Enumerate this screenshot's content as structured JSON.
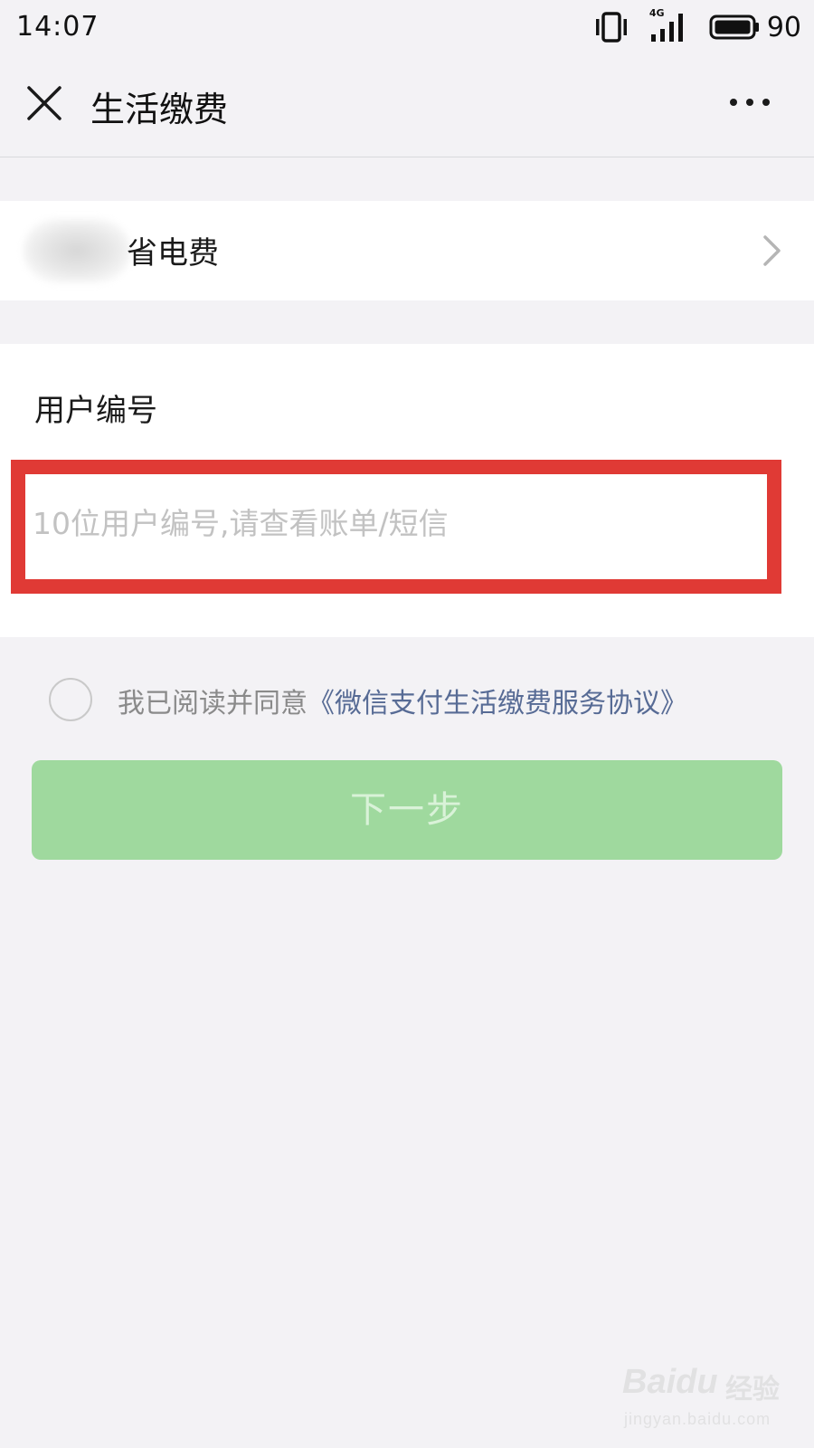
{
  "status_bar": {
    "time": "14:07",
    "network": "4G",
    "battery": "90"
  },
  "nav": {
    "title": "生活缴费"
  },
  "provider": {
    "label": "省电费"
  },
  "form": {
    "field_label": "用户编号",
    "account_placeholder": "10位用户编号,请查看账单/短信",
    "account_value": ""
  },
  "agreement": {
    "prefix": "我已阅读并同意",
    "link": "《微信支付生活缴费服务协议》",
    "checked": false
  },
  "next_button": {
    "label": "下一步",
    "enabled": false
  },
  "watermark": {
    "brand": "Baidu",
    "jingyan": "经验",
    "url": "jingyan.baidu.com"
  },
  "colors": {
    "page_bg": "#f3f2f5",
    "highlight_border": "#e03a35",
    "link": "#576b95",
    "button_disabled": "#9fd99e"
  }
}
